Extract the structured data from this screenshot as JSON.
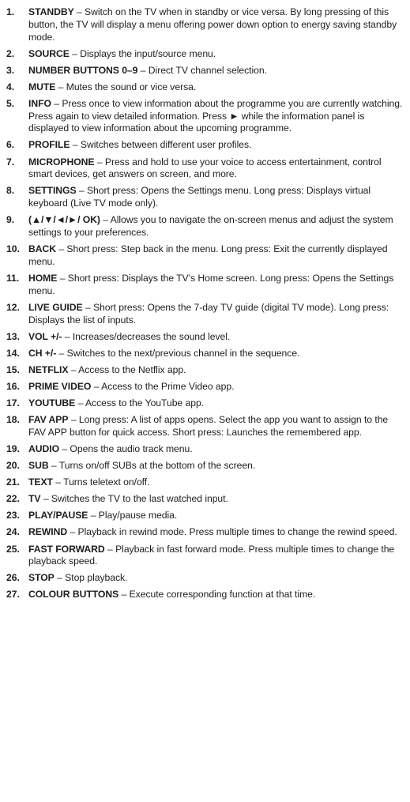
{
  "items": [
    {
      "num": "1.",
      "term": "STANDBY",
      "desc": " – Switch on the TV when in standby or vice versa. By long pressing of this button, the TV will display a menu offering power down option to energy saving standby mode."
    },
    {
      "num": "2.",
      "term": "SOURCE",
      "desc": " – Displays the input/source menu."
    },
    {
      "num": "3.",
      "term": "NUMBER BUTTONS 0–9",
      "desc": " – Direct TV channel selection."
    },
    {
      "num": "4.",
      "term": "MUTE",
      "desc": " – Mutes the sound or vice versa."
    },
    {
      "num": "5.",
      "term": "INFO",
      "desc": " – Press once to view information about the programme you are currently watching. Press again to view detailed information. Press ► while the information panel is displayed to view information about the upcoming programme."
    },
    {
      "num": "6.",
      "term": "PROFILE",
      "desc": " – Switches between different user profiles."
    },
    {
      "num": "7.",
      "term": "MICROPHONE",
      "desc": " – Press and hold to use your voice to access entertainment, control smart devices, get answers on screen, and more."
    },
    {
      "num": "8.",
      "term": "SETTINGS",
      "desc": " – Short press: Opens the Settings menu. Long press: Displays virtual keyboard (Live TV mode only)."
    },
    {
      "num": "9.",
      "term": "(▲/▼/◄/►/ OK)",
      "desc": " – Allows you to navigate the on-screen menus and adjust the system settings to your preferences."
    },
    {
      "num": "10.",
      "term": "BACK",
      "desc": " – Short press: Step back in the menu. Long press: Exit the currently displayed menu."
    },
    {
      "num": "11.",
      "term": "HOME",
      "desc": " – Short press: Displays the TV’s Home screen. Long press: Opens the Settings menu."
    },
    {
      "num": "12.",
      "term": "LIVE GUIDE",
      "desc": " – Short press: Opens the 7-day TV guide (digital TV mode). Long press: Displays the list of inputs."
    },
    {
      "num": "13.",
      "term": "VOL +/-",
      "desc": " – Increases/decreases the sound level."
    },
    {
      "num": "14.",
      "term": "CH +/-",
      "desc": " – Switches to the next/previous channel in the sequence."
    },
    {
      "num": "15.",
      "term": "NETFLIX",
      "desc": " – Access to the Netflix app."
    },
    {
      "num": "16.",
      "term": "PRIME VIDEO",
      "desc": " – Access to the Prime Video app."
    },
    {
      "num": "17.",
      "term": "YOUTUBE",
      "desc": " – Access to the YouTube app."
    },
    {
      "num": "18.",
      "term": "FAV APP",
      "desc": " – Long press: A list of apps opens. Select the app you want to assign to the FAV APP button for quick access. Short press: Launches the remembered app."
    },
    {
      "num": "19.",
      "term": "AUDIO",
      "desc": " – Opens the audio track menu."
    },
    {
      "num": "20.",
      "term": "SUB",
      "desc": " – Turns on/off SUBs at the bottom of the screen."
    },
    {
      "num": "21.",
      "term": "TEXT",
      "desc": " – Turns teletext on/off."
    },
    {
      "num": "22.",
      "term": "TV",
      "desc": " – Switches the TV to the last watched input."
    },
    {
      "num": "23.",
      "term": "PLAY/PAUSE",
      "desc": " – Play/pause media."
    },
    {
      "num": "24.",
      "term": "REWIND",
      "desc": " – Playback in rewind mode. Press multiple times to change the rewind speed."
    },
    {
      "num": "25.",
      "term": "FAST FORWARD",
      "desc": " – Playback in fast forward mode. Press multiple times to change the playback speed."
    },
    {
      "num": "26.",
      "term": "STOP",
      "desc": " – Stop playback."
    },
    {
      "num": "27.",
      "term": "COLOUR BUTTONS",
      "desc": " – Execute corresponding function at that time."
    }
  ]
}
